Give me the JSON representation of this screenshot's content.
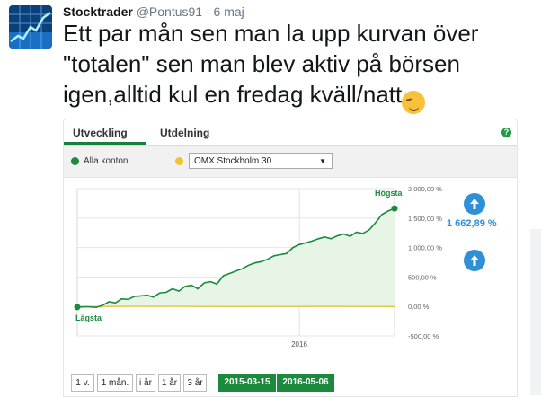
{
  "tweet": {
    "name": "Stocktrader",
    "handle": "@Pontus91",
    "dot": "·",
    "date": "6 maj",
    "text": "Ett par mån sen man la upp kurvan över \"totalen\" sen man blev aktiv på börsen igen,alltid kul en fredag kväll/natt",
    "emoji": "smirking-face"
  },
  "card": {
    "tabs": [
      {
        "label": "Utveckling",
        "active": true
      },
      {
        "label": "Utdelning",
        "active": false
      }
    ],
    "help": "?",
    "legend": {
      "primary_label": "Alla konton",
      "primary_color": "#1b8a3c",
      "benchmark_color": "#f2c12e",
      "benchmark_select": "OMX Stockholm 30"
    },
    "chart_data": {
      "type": "area",
      "y_ticks": [
        "2 000,00 %",
        "1 500,00 %",
        "1 000,00 %",
        "500,00 %",
        "0,00 %",
        "-500,00 %"
      ],
      "ylim": [
        -500,
        2000
      ],
      "x_tick": "2016",
      "grid": true,
      "label_high": "Högsta",
      "label_low": "Lägsta",
      "series": [
        {
          "color": "#1b8a3c",
          "points": [
            [
              0,
              -10
            ],
            [
              0.03,
              -5
            ],
            [
              0.06,
              -15
            ],
            [
              0.08,
              20
            ],
            [
              0.1,
              80
            ],
            [
              0.12,
              60
            ],
            [
              0.14,
              130
            ],
            [
              0.16,
              120
            ],
            [
              0.18,
              170
            ],
            [
              0.2,
              180
            ],
            [
              0.22,
              190
            ],
            [
              0.24,
              160
            ],
            [
              0.26,
              230
            ],
            [
              0.28,
              240
            ],
            [
              0.3,
              300
            ],
            [
              0.32,
              260
            ],
            [
              0.34,
              340
            ],
            [
              0.36,
              360
            ],
            [
              0.38,
              300
            ],
            [
              0.4,
              400
            ],
            [
              0.42,
              420
            ],
            [
              0.44,
              380
            ],
            [
              0.46,
              520
            ],
            [
              0.48,
              560
            ],
            [
              0.5,
              600
            ],
            [
              0.52,
              640
            ],
            [
              0.54,
              700
            ],
            [
              0.56,
              740
            ],
            [
              0.58,
              760
            ],
            [
              0.6,
              800
            ],
            [
              0.62,
              860
            ],
            [
              0.64,
              880
            ],
            [
              0.66,
              900
            ],
            [
              0.68,
              1000
            ],
            [
              0.7,
              1050
            ],
            [
              0.72,
              1080
            ],
            [
              0.74,
              1110
            ],
            [
              0.76,
              1150
            ],
            [
              0.78,
              1180
            ],
            [
              0.8,
              1150
            ],
            [
              0.82,
              1200
            ],
            [
              0.84,
              1230
            ],
            [
              0.86,
              1190
            ],
            [
              0.88,
              1260
            ],
            [
              0.9,
              1240
            ],
            [
              0.92,
              1300
            ],
            [
              0.94,
              1420
            ],
            [
              0.96,
              1560
            ],
            [
              0.98,
              1620
            ],
            [
              1.0,
              1662.89
            ]
          ]
        },
        {
          "color": "#e8c84a",
          "points": [
            [
              0,
              0
            ],
            [
              0.25,
              3
            ],
            [
              0.5,
              -2
            ],
            [
              0.75,
              1
            ],
            [
              1.0,
              0
            ]
          ]
        }
      ],
      "summary_value": "1 662,89 %"
    },
    "periods": [
      "1 v.",
      "1 mån.",
      "i år",
      "1 år",
      "3 år"
    ],
    "date_from": "2015-03-15",
    "date_to": "2016-05-06"
  }
}
